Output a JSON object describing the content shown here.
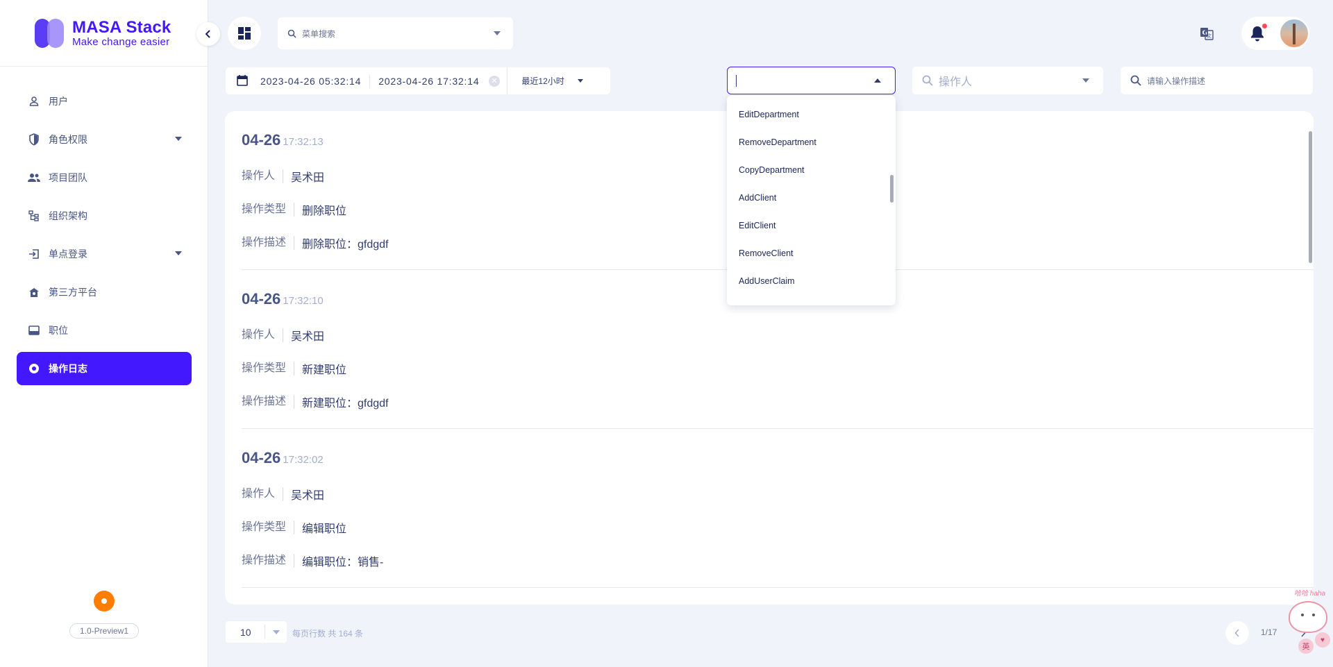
{
  "brand": {
    "name": "MASA Stack",
    "tagline": "Make change easier"
  },
  "sidebar": {
    "items": [
      {
        "label": "用户",
        "icon": "user-icon"
      },
      {
        "label": "角色权限",
        "icon": "shield-icon",
        "expandable": true
      },
      {
        "label": "项目团队",
        "icon": "team-icon"
      },
      {
        "label": "组织架构",
        "icon": "org-chart-icon"
      },
      {
        "label": "单点登录",
        "icon": "login-icon",
        "expandable": true
      },
      {
        "label": "第三方平台",
        "icon": "platform-icon"
      },
      {
        "label": "职位",
        "icon": "position-icon"
      },
      {
        "label": "操作日志",
        "icon": "record-icon",
        "active": true
      }
    ],
    "version": "1.0-Preview1"
  },
  "header": {
    "menu_search_placeholder": "菜单搜索"
  },
  "filters": {
    "start_time": "2023-04-26 05:32:14",
    "end_time": "2023-04-26 17:32:14",
    "quick_range": "最近12小时",
    "operation_type_value": "",
    "operator_placeholder": "操作人",
    "description_placeholder": "请输入操作描述"
  },
  "operation_type_dropdown": {
    "options": [
      "EditDepartment",
      "RemoveDepartment",
      "CopyDepartment",
      "AddClient",
      "EditClient",
      "RemoveClient",
      "AddUserClaim"
    ]
  },
  "labels": {
    "operator": "操作人",
    "operation_type": "操作类型",
    "operation_desc": "操作描述"
  },
  "logs": [
    {
      "date": "04-26",
      "time": "17:32:13",
      "operator": "吴术田",
      "type": "删除职位",
      "desc": "删除职位：gfdgdf"
    },
    {
      "date": "04-26",
      "time": "17:32:10",
      "operator": "吴术田",
      "type": "新建职位",
      "desc": "新建职位：gfdgdf"
    },
    {
      "date": "04-26",
      "time": "17:32:02",
      "operator": "吴术田",
      "type": "编辑职位",
      "desc": "编辑职位：销售-"
    }
  ],
  "pagination": {
    "page_size": "10",
    "info": "每页行数  共 164 条",
    "page_count": "1/17"
  },
  "mascot": {
    "caption": "哈哈 haha",
    "badge_lang": "英",
    "badge_icon": "♥"
  },
  "colors": {
    "accent": "#4318FF",
    "orange": "#FF7D00"
  }
}
